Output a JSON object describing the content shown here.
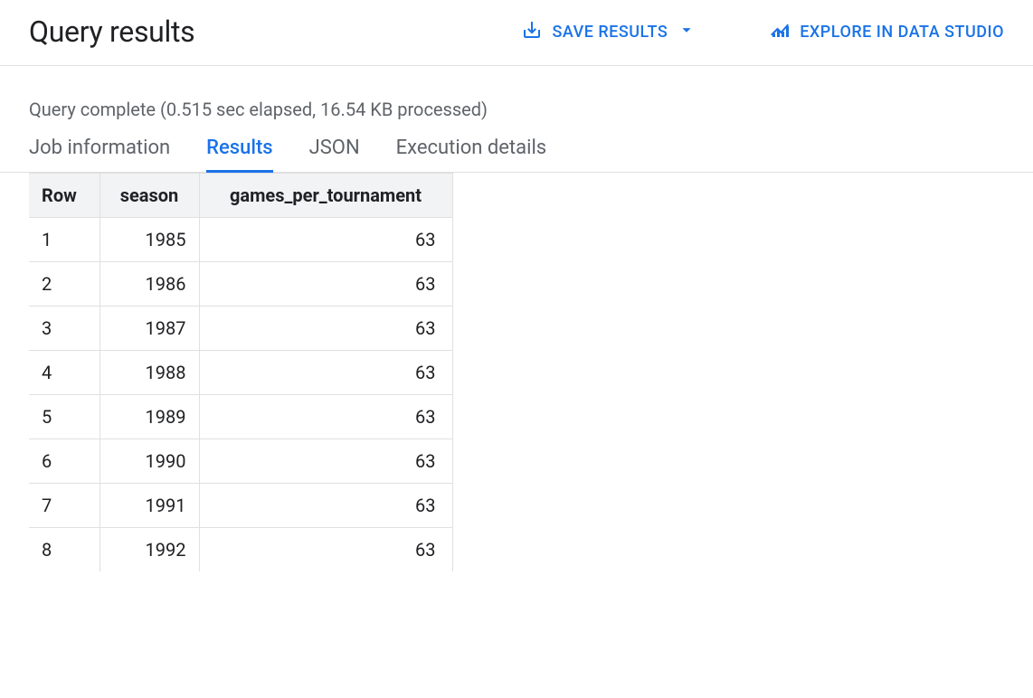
{
  "header": {
    "title": "Query results",
    "save_results_label": "SAVE RESULTS",
    "explore_label": "EXPLORE IN DATA STUDIO"
  },
  "status": {
    "text": "Query complete (0.515 sec elapsed, 16.54 KB processed)"
  },
  "tabs": [
    {
      "label": "Job information",
      "active": false
    },
    {
      "label": "Results",
      "active": true
    },
    {
      "label": "JSON",
      "active": false
    },
    {
      "label": "Execution details",
      "active": false
    }
  ],
  "table": {
    "columns": [
      "Row",
      "season",
      "games_per_tournament"
    ],
    "rows": [
      {
        "row": "1",
        "season": "1985",
        "games_per_tournament": "63"
      },
      {
        "row": "2",
        "season": "1986",
        "games_per_tournament": "63"
      },
      {
        "row": "3",
        "season": "1987",
        "games_per_tournament": "63"
      },
      {
        "row": "4",
        "season": "1988",
        "games_per_tournament": "63"
      },
      {
        "row": "5",
        "season": "1989",
        "games_per_tournament": "63"
      },
      {
        "row": "6",
        "season": "1990",
        "games_per_tournament": "63"
      },
      {
        "row": "7",
        "season": "1991",
        "games_per_tournament": "63"
      },
      {
        "row": "8",
        "season": "1992",
        "games_per_tournament": "63"
      }
    ]
  }
}
